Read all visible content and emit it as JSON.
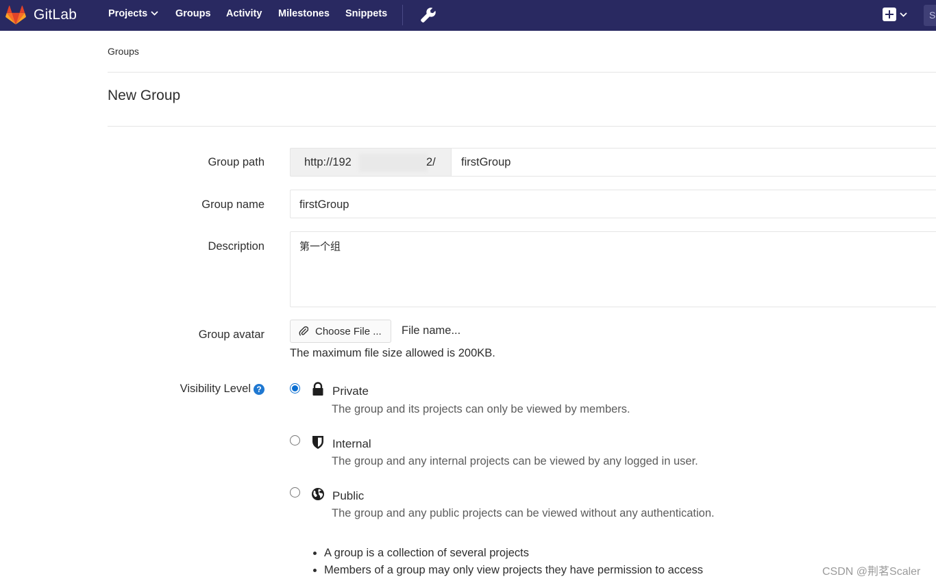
{
  "app": {
    "name": "GitLab"
  },
  "nav": {
    "items": [
      {
        "label": "Projects"
      },
      {
        "label": "Groups"
      },
      {
        "label": "Activity"
      },
      {
        "label": "Milestones"
      },
      {
        "label": "Snippets"
      }
    ],
    "search_placeholder": "S"
  },
  "breadcrumb": "Groups",
  "page_title": "New Group",
  "form": {
    "group_path": {
      "label": "Group path",
      "prefix_start": "http://192",
      "prefix_end": "2/",
      "value": "firstGroup"
    },
    "group_name": {
      "label": "Group name",
      "value": "firstGroup"
    },
    "description": {
      "label": "Description",
      "value": "第一个组"
    },
    "avatar": {
      "label": "Group avatar",
      "button": "Choose File ...",
      "file_name": "File name...",
      "help": "The maximum file size allowed is 200KB."
    },
    "visibility": {
      "label": "Visibility Level",
      "help_icon": "?",
      "options": [
        {
          "title": "Private",
          "description": "The group and its projects can only be viewed by members.",
          "icon": "lock-icon",
          "checked": true
        },
        {
          "title": "Internal",
          "description": "The group and any internal projects can be viewed by any logged in user.",
          "icon": "shield-icon",
          "checked": false
        },
        {
          "title": "Public",
          "description": "The group and any public projects can be viewed without any authentication.",
          "icon": "globe-icon",
          "checked": false
        }
      ]
    },
    "notes": [
      "A group is a collection of several projects",
      "Members of a group may only view projects they have permission to access"
    ]
  },
  "watermark": "CSDN @荆茗Scaler",
  "colors": {
    "navbar": "#292961",
    "accent": "#1f78d1",
    "logo_orange": "#fc6d26",
    "logo_red": "#e24329",
    "logo_light": "#fca326"
  }
}
